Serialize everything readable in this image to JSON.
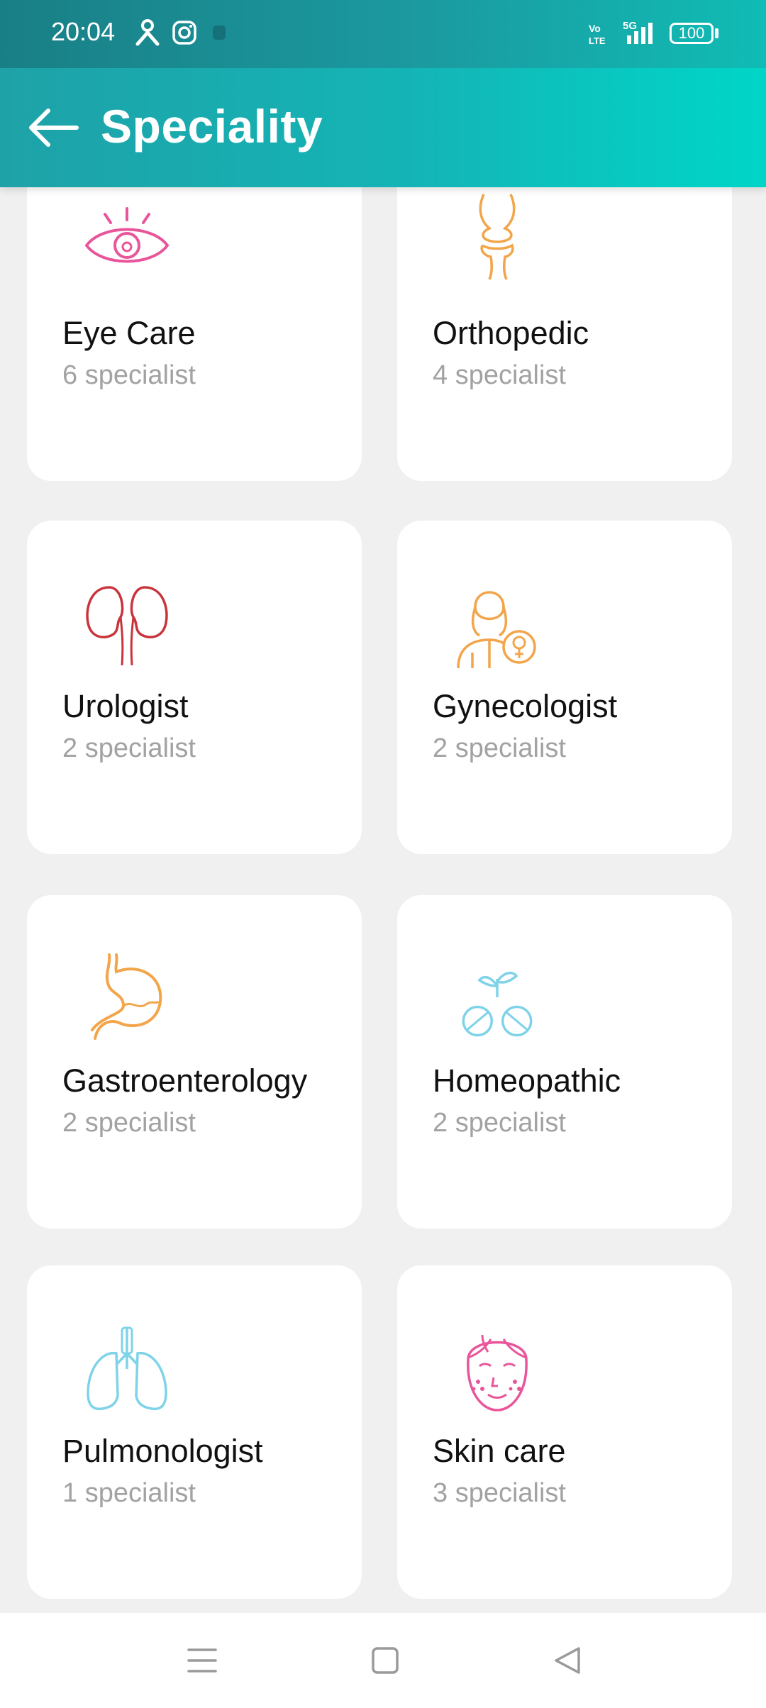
{
  "status": {
    "time": "20:04",
    "battery": "100"
  },
  "header": {
    "title": "Speciality"
  },
  "specialities": [
    {
      "name": "Eye Care",
      "count": "6 specialist",
      "icon": "eye-icon",
      "color": "#e9559a"
    },
    {
      "name": "Orthopedic",
      "count": "4 specialist",
      "icon": "bone-joint-icon",
      "color": "#f2a54a"
    },
    {
      "name": "Urologist",
      "count": "2 specialist",
      "icon": "kidney-icon",
      "color": "#c9343c"
    },
    {
      "name": "Gynecologist",
      "count": "2 specialist",
      "icon": "female-doctor-icon",
      "color": "#f2a54a"
    },
    {
      "name": "Gastroenterology",
      "count": "2 specialist",
      "icon": "stomach-icon",
      "color": "#f2a54a"
    },
    {
      "name": "Homeopathic",
      "count": "2 specialist",
      "icon": "herbal-capsule-icon",
      "color": "#7fd3e8"
    },
    {
      "name": "Pulmonologist",
      "count": "1 specialist",
      "icon": "lungs-icon",
      "color": "#7fd3e8"
    },
    {
      "name": "Skin care",
      "count": "3 specialist",
      "icon": "face-skin-icon",
      "color": "#e9559a"
    }
  ],
  "colors": {
    "header_start": "#1ea2a8",
    "header_end": "#00d6c8",
    "background": "#f0f0f0"
  }
}
